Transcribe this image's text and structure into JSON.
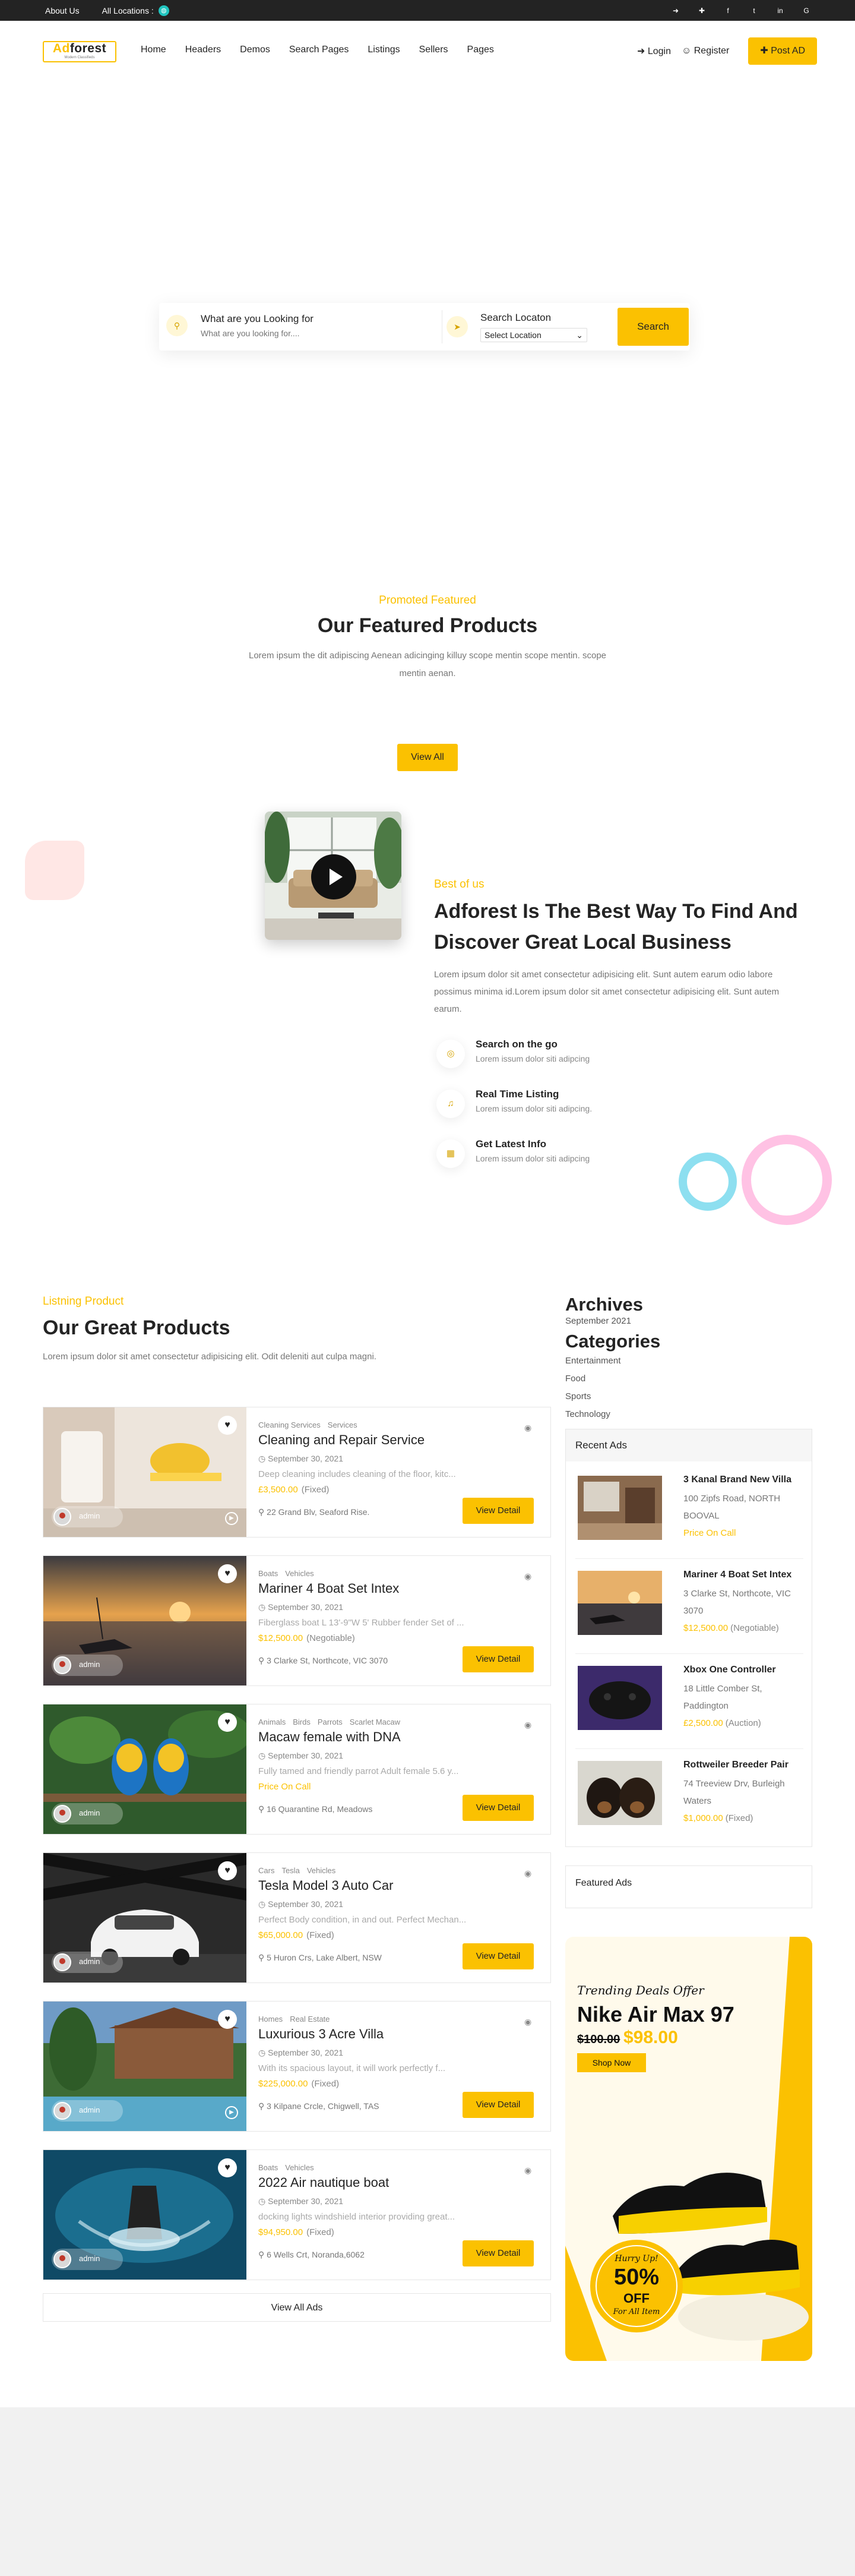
{
  "topbar": {
    "about": "About Us",
    "locations": "All Locations :"
  },
  "header": {
    "logo_main": "Ad",
    "logo_rest": "forest",
    "logo_tagline": "Modern Classifieds",
    "nav": [
      "Home",
      "Headers",
      "Demos",
      "Search Pages",
      "Listings",
      "Sellers",
      "Pages"
    ],
    "login": "Login",
    "register": "Register",
    "post_ad": "Post AD"
  },
  "search": {
    "title": "What are you Looking for",
    "placeholder": "What are you looking for....",
    "location_title": "Search Locaton",
    "location_value": "Select Location",
    "button": "Search"
  },
  "featured": {
    "kicker": "Promoted Featured",
    "title": "Our Featured Products",
    "text": "Lorem ipsum the dit adipiscing Aenean adicinging killuy scope mentin scope mentin. scope mentin aenan.",
    "view_all": "View All"
  },
  "about": {
    "kicker": "Best of us",
    "title": "Adforest Is The Best Way To Find And Discover Great Local Business",
    "text": "Lorem ipsum dolor sit amet consectetur adipisicing elit. Sunt autem earum odio labore possimus minima id.Lorem ipsum dolor sit amet consectetur adipisicing elit. Sunt autem earum.",
    "features": [
      {
        "title": "Search on the go",
        "desc": "Lorem issum dolor siti adipcing"
      },
      {
        "title": "Real Time Listing",
        "desc": "Lorem issum dolor siti adipcing."
      },
      {
        "title": "Get Latest Info",
        "desc": "Lorem issum dolor siti adipcing"
      }
    ]
  },
  "products": {
    "kicker": "Listning Product",
    "title": "Our Great Products",
    "text": "Lorem ipsum dolor sit amet consectetur adipisicing elit. Odit deleniti aut culpa magni.",
    "view_all": "View All Ads",
    "user": "admin",
    "view_detail": "View Detail",
    "items": [
      {
        "cats": [
          "Cleaning Services",
          "Services"
        ],
        "title": "Cleaning and Repair Service",
        "date": "September 30, 2021",
        "desc": "Deep cleaning includes cleaning of the floor, kitc...",
        "price": "£3,500.00",
        "ptype": "(Fixed)",
        "address": "22 Grand Blv, Seaford Rise."
      },
      {
        "cats": [
          "Boats",
          "Vehicles"
        ],
        "title": "Mariner 4 Boat Set Intex",
        "date": "September 30, 2021",
        "desc": "Fiberglass boat L 13'-9\"W 5' Rubber fender Set of ...",
        "price": "$12,500.00",
        "ptype": "(Negotiable)",
        "address": "3 Clarke St, Northcote, VIC 3070"
      },
      {
        "cats": [
          "Animals",
          "Birds",
          "Parrots",
          "Scarlet Macaw"
        ],
        "title": "Macaw female with DNA",
        "date": "September 30, 2021",
        "desc": "Fully tamed and friendly parrot Adult female 5.6 y...",
        "price": "Price On Call",
        "ptype": "",
        "address": "16 Quarantine Rd, Meadows"
      },
      {
        "cats": [
          "Cars",
          "Tesla",
          "Vehicles"
        ],
        "title": "Tesla Model 3 Auto Car",
        "date": "September 30, 2021",
        "desc": "Perfect Body condition, in and out. Perfect Mechan...",
        "price": "$65,000.00",
        "ptype": "(Fixed)",
        "address": "5 Huron Crs, Lake Albert, NSW"
      },
      {
        "cats": [
          "Homes",
          "Real Estate"
        ],
        "title": "Luxurious 3 Acre Villa",
        "date": "September 30, 2021",
        "desc": "With its spacious layout, it will work perfectly f...",
        "price": "$225,000.00",
        "ptype": "(Fixed)",
        "address": "3 Kilpane Crcle, Chigwell, TAS"
      },
      {
        "cats": [
          "Boats",
          "Vehicles"
        ],
        "title": "2022 Air nautique boat",
        "date": "September 30, 2021",
        "desc": "docking lights windshield interior providing great...",
        "price": "$94,950.00",
        "ptype": "(Fixed)",
        "address": "6 Wells Crt, Noranda,6062"
      }
    ]
  },
  "sidebar": {
    "archives_title": "Archives",
    "archives": [
      "September 2021"
    ],
    "categories_title": "Categories",
    "categories": [
      "Entertainment",
      "Food",
      "Sports",
      "Technology"
    ],
    "recent_title": "Recent Ads",
    "recent": [
      {
        "title": "3 Kanal Brand New Villa",
        "address": "100 Zipfs Road, NORTH BOOVAL",
        "price": "Price On Call",
        "ptype": ""
      },
      {
        "title": "Mariner 4 Boat Set Intex",
        "address": "3 Clarke St, Northcote, VIC 3070",
        "price": "$12,500.00",
        "ptype": "(Negotiable)"
      },
      {
        "title": "Xbox One Controller",
        "address": "18 Little Comber St, Paddington",
        "price": "£2,500.00",
        "ptype": "(Auction)"
      },
      {
        "title": "Rottweiler Breeder Pair",
        "address": "74 Treeview Drv, Burleigh Waters",
        "price": "$1,000.00",
        "ptype": "(Fixed)"
      }
    ],
    "featured_ads": "Featured Ads",
    "promo": {
      "kicker": "Trending Deals Offer",
      "title": "Nike Air Max 97",
      "old_price": "$100.00",
      "new_price": "$98.00",
      "button": "Shop Now",
      "badge_top": "Hurry Up!",
      "badge_pct": "50%",
      "badge_off": "OFF",
      "badge_bottom": "For All Item"
    }
  }
}
